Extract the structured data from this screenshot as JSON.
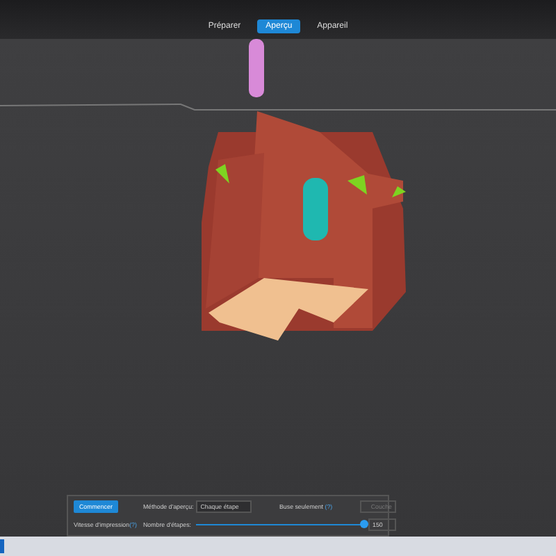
{
  "tabs": [
    {
      "label": "Préparer",
      "selected": false
    },
    {
      "label": "Aperçu",
      "selected": true
    },
    {
      "label": "Appareil",
      "selected": false
    }
  ],
  "preview_panel": {
    "start_button": "Commencer",
    "speed_label": "Vitesse d'impression",
    "speed_help": "(?)",
    "method_label": "Méthode d'aperçu:",
    "method_value": "Chaque étape",
    "only_label": "Buse seulement",
    "only_help": "(?)",
    "only_field": "Couche",
    "only_disabled": true,
    "steps_label": "Nombre d'étapes:",
    "steps_slider": {
      "level": 1
    },
    "steps_value": "150"
  }
}
